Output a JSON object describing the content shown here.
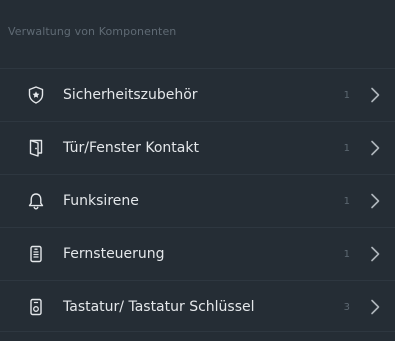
{
  "section": {
    "title": "Verwaltung von Komponenten"
  },
  "items": [
    {
      "label": "Sicherheitszubehör",
      "count": "1",
      "icon": "shield-star-icon"
    },
    {
      "label": "Tür/Fenster Kontakt",
      "count": "1",
      "icon": "door-icon"
    },
    {
      "label": "Funksirene",
      "count": "1",
      "icon": "bell-icon"
    },
    {
      "label": "Fernsteuerung",
      "count": "1",
      "icon": "remote-control-icon"
    },
    {
      "label": "Tastatur/ Tastatur Schlüssel",
      "count": "3",
      "icon": "keypad-icon"
    }
  ],
  "colors": {
    "background": "#252d35",
    "text": "#e4e7ea",
    "muted": "#5d6872"
  }
}
